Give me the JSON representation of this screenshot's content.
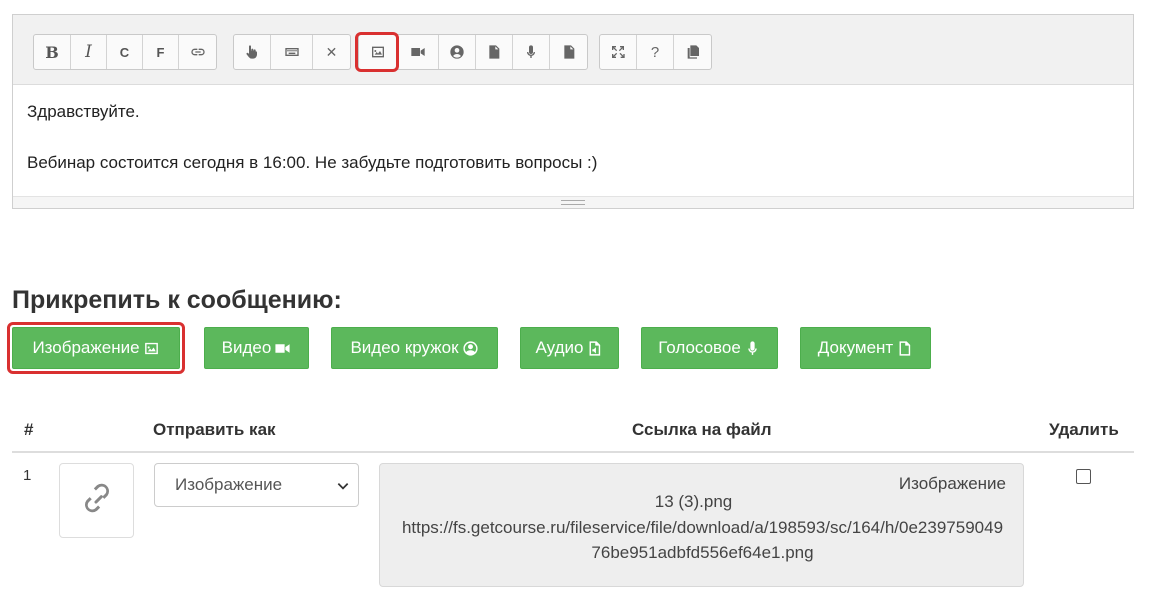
{
  "editor": {
    "toolbar": {
      "group1": [
        "bold-icon",
        "italic-icon",
        "C",
        "F",
        "link-icon"
      ],
      "bold_glyph": "B",
      "italic_glyph": "I",
      "c_label": "C",
      "f_label": "F",
      "clear_glyph": "✕",
      "help_glyph": "?",
      "highlighted_button": "image-icon",
      "highlight_color": "#d93030"
    },
    "lines": [
      "Здравствуйте.",
      "Вебинар состоится сегодня в 16:00. Не забудьте подготовить вопросы :)"
    ]
  },
  "attach": {
    "title": "Прикрепить к сообщению:",
    "buttons": {
      "image": "Изображение",
      "video": "Видео",
      "video_circle": "Видео кружок",
      "audio": "Аудио",
      "voice": "Голосовое",
      "document": "Документ"
    },
    "button_color": "#5cb85c"
  },
  "table": {
    "headers": {
      "num": "#",
      "send_as": "Отправить как",
      "link": "Ссылка на файл",
      "delete": "Удалить"
    },
    "rows": [
      {
        "num": "1",
        "send_as": "Изображение",
        "file_type": "Изображение",
        "file_name": "13 (3).png",
        "file_url": "https://fs.getcourse.ru/fileservice/file/download/a/198593/sc/164/h/0e23975904976be951adbfd556ef64e1.png",
        "delete_checked": false
      }
    ]
  }
}
